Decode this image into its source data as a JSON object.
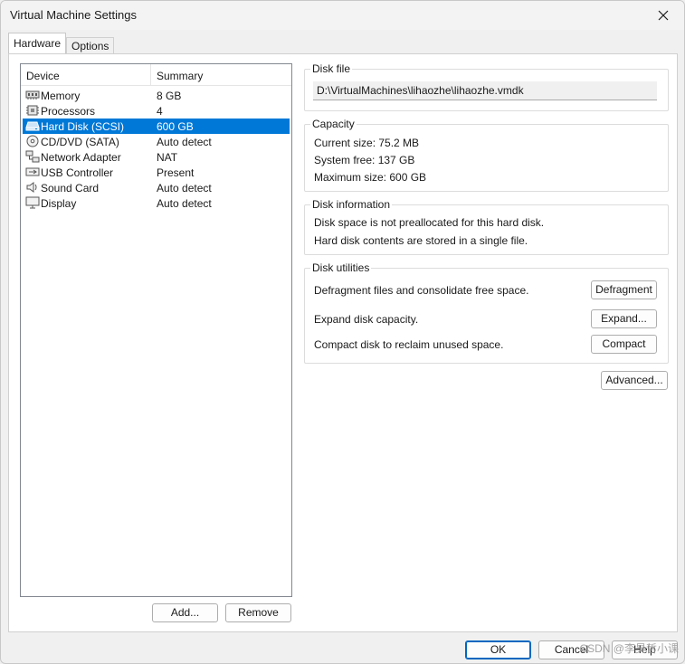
{
  "window": {
    "title": "Virtual Machine Settings"
  },
  "tabs": [
    {
      "label": "Hardware",
      "active": true
    },
    {
      "label": "Options",
      "active": false
    }
  ],
  "device_list": {
    "headers": {
      "device": "Device",
      "summary": "Summary"
    },
    "items": [
      {
        "name": "Memory",
        "summary": "8 GB",
        "icon": "memory-icon"
      },
      {
        "name": "Processors",
        "summary": "4",
        "icon": "processor-icon"
      },
      {
        "name": "Hard Disk (SCSI)",
        "summary": "600 GB",
        "icon": "hard-disk-icon",
        "selected": true
      },
      {
        "name": "CD/DVD (SATA)",
        "summary": "Auto detect",
        "icon": "cd-dvd-icon"
      },
      {
        "name": "Network Adapter",
        "summary": "NAT",
        "icon": "network-adapter-icon"
      },
      {
        "name": "USB Controller",
        "summary": "Present",
        "icon": "usb-icon"
      },
      {
        "name": "Sound Card",
        "summary": "Auto detect",
        "icon": "speaker-icon"
      },
      {
        "name": "Display",
        "summary": "Auto detect",
        "icon": "monitor-icon"
      }
    ],
    "add_label": "Add...",
    "remove_label": "Remove"
  },
  "disk_file": {
    "legend": "Disk file",
    "path": "D:\\VirtualMachines\\lihaozhe\\lihaozhe.vmdk"
  },
  "capacity": {
    "legend": "Capacity",
    "current_size": "Current size:  75.2 MB",
    "system_free": "System free:  137 GB",
    "maximum_size": "Maximum size:  600 GB"
  },
  "disk_information": {
    "legend": "Disk information",
    "line1": "Disk space is not preallocated for this hard disk.",
    "line2": "Hard disk contents are stored in a single file."
  },
  "disk_utilities": {
    "legend": "Disk utilities",
    "defrag_text": "Defragment files and consolidate free space.",
    "defrag_label": "Defragment",
    "expand_text": "Expand disk capacity.",
    "expand_label": "Expand...",
    "compact_text": "Compact disk to reclaim unused space.",
    "compact_label": "Compact"
  },
  "advanced_label": "Advanced...",
  "footer": {
    "ok_label": "OK",
    "cancel_label": "Cancel",
    "help_label": "Help"
  },
  "watermark": "CSDN @李昊哲小课",
  "colors": {
    "selection": "#0078d7",
    "default_button_border": "#0067c0"
  }
}
